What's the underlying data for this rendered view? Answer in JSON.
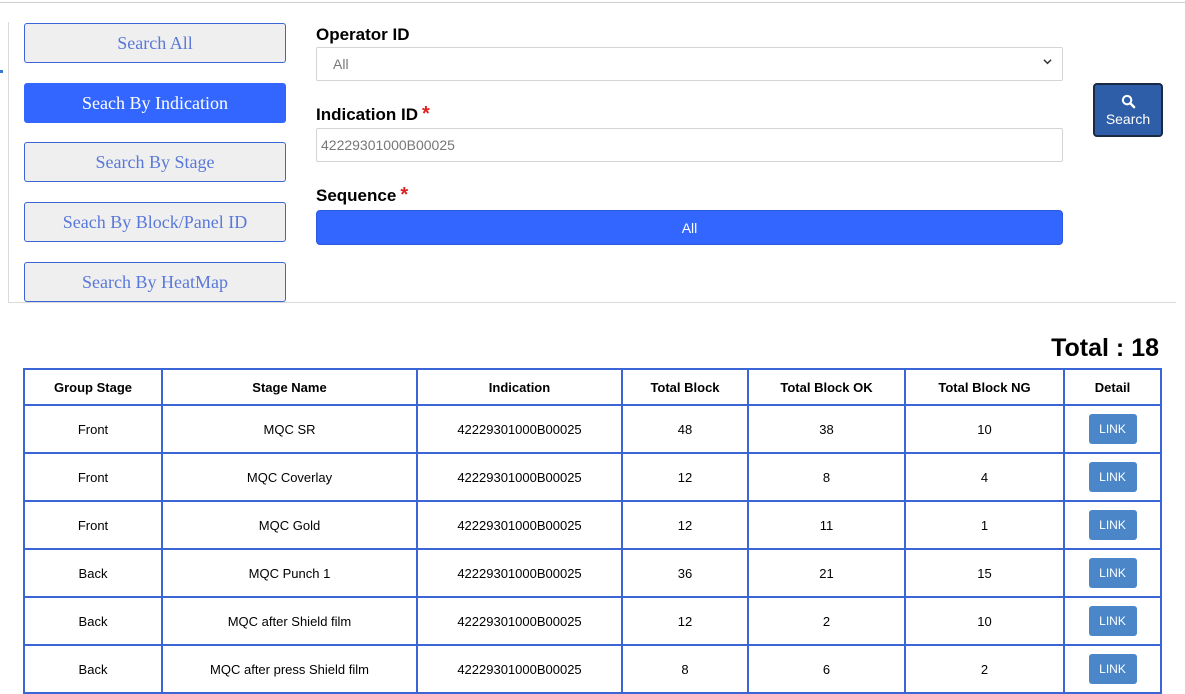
{
  "sidebar": {
    "buttons": [
      {
        "label": "Search All",
        "active": false
      },
      {
        "label": "Seach By Indication",
        "active": true
      },
      {
        "label": "Search By Stage",
        "active": false
      },
      {
        "label": "Seach By Block/Panel ID",
        "active": false
      },
      {
        "label": "Search By HeatMap",
        "active": false
      }
    ]
  },
  "form": {
    "operator_label": "Operator ID",
    "operator_value": "All",
    "indication_label": "Indication ID",
    "indication_value": "42229301000B00025",
    "sequence_label": "Sequence",
    "sequence_value": "All",
    "required_mark": "*"
  },
  "search_button": {
    "label": "Search",
    "icon": "search-icon"
  },
  "results": {
    "total_label": "Total : 18",
    "columns": [
      "Group Stage",
      "Stage Name",
      "Indication",
      "Total Block",
      "Total Block OK",
      "Total Block NG",
      "Detail"
    ],
    "rows": [
      [
        "Front",
        "MQC SR",
        "42229301000B00025",
        "48",
        "38",
        "10",
        "LINK"
      ],
      [
        "Front",
        "MQC Coverlay",
        "42229301000B00025",
        "12",
        "8",
        "4",
        "LINK"
      ],
      [
        "Front",
        "MQC Gold",
        "42229301000B00025",
        "12",
        "11",
        "1",
        "LINK"
      ],
      [
        "Back",
        "MQC Punch 1",
        "42229301000B00025",
        "36",
        "21",
        "15",
        "LINK"
      ],
      [
        "Back",
        "MQC after Shield film",
        "42229301000B00025",
        "12",
        "2",
        "10",
        "LINK"
      ],
      [
        "Back",
        "MQC after press Shield film",
        "42229301000B00025",
        "8",
        "6",
        "2",
        "LINK"
      ]
    ]
  },
  "colors": {
    "accent": "#3366ff",
    "table_border": "#3b64d6",
    "link": "#4a86c8",
    "required": "#e02020"
  }
}
